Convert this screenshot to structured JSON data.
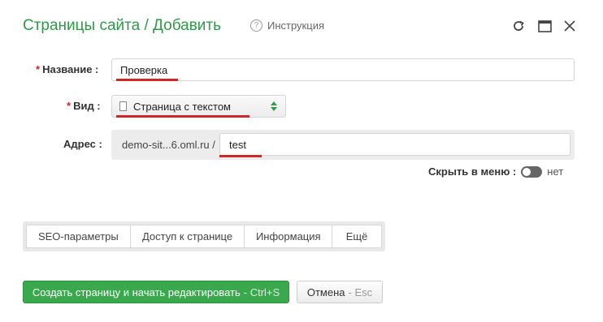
{
  "header": {
    "title": "Страницы сайта / Добавить",
    "help_label": "Инструкция",
    "help_icon": "question-circle-icon"
  },
  "window_controls": [
    "refresh-icon",
    "maximize-icon",
    "close-icon"
  ],
  "form": {
    "name": {
      "label": "Название :",
      "value": "Проверка",
      "required": "*"
    },
    "type": {
      "label": "Вид :",
      "value": "Страница с текстом",
      "required": "*"
    },
    "address": {
      "label": "Адрес :",
      "prefix": "demo-sit...6.oml.ru /",
      "value": "test"
    },
    "hide_menu": {
      "label": "Скрыть в меню :",
      "value": "нет"
    }
  },
  "tabs": [
    "SEO-параметры",
    "Доступ к странице",
    "Информация",
    "Ещё"
  ],
  "buttons": {
    "create_label": "Создать страницу и начать редактировать",
    "create_shortcut": "- Ctrl+S",
    "cancel_label": "Отмена",
    "cancel_shortcut": "- Esc"
  },
  "colors": {
    "accent_green": "#2e9a48",
    "required_red": "#d0262a",
    "annotation_red": "#d0262a"
  }
}
